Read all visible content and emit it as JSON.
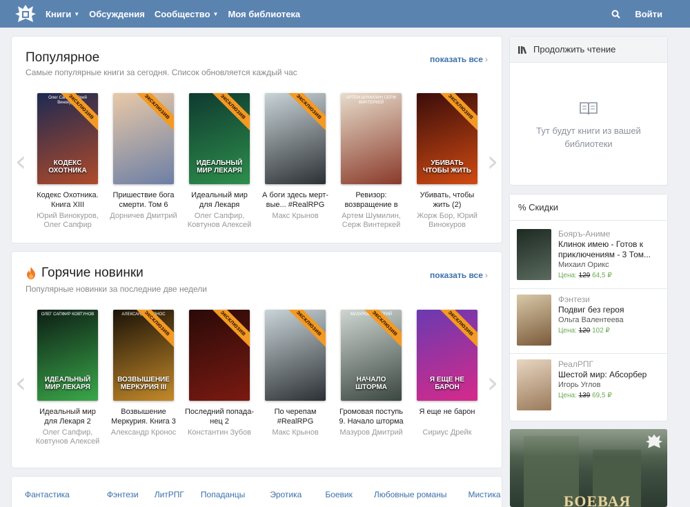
{
  "topbar": {
    "nav": [
      {
        "label": "Книги",
        "dropdown": true
      },
      {
        "label": "Обсуждения",
        "dropdown": false
      },
      {
        "label": "Сообщество",
        "dropdown": true
      },
      {
        "label": "Моя библиотека",
        "dropdown": false
      }
    ],
    "login_label": "Войти"
  },
  "popular": {
    "title": "Популярное",
    "subtitle": "Самые популярные книги за сегодня. Список обновляется каждый час",
    "show_all": "показать все",
    "books": [
      {
        "title": "Кодекс Охотника. Книга XIII",
        "author": "Юрий Винокуров, Олег Сапфир",
        "exclusive": true,
        "cover_top": "Олег Сапфир Юрий Винокуров",
        "cover_text": "КОДЕКС ОХОТНИКА",
        "colors": [
          "#1d2a52",
          "#b04a2a"
        ]
      },
      {
        "title": "Пришествие бога смерти. Том 6",
        "author": "Дорничев Дмитрий",
        "exclusive": true,
        "cover_top": "",
        "cover_text": "",
        "colors": [
          "#e9c9a7",
          "#6c7fa6"
        ]
      },
      {
        "title": "Идеальный мир для Лекаря",
        "author": "Олег Сапфир, Ковтунов Алексей",
        "exclusive": true,
        "cover_top": "",
        "cover_text": "ИДЕАЛЬНЫЙ МИР ЛЕКАРЯ",
        "colors": [
          "#0f3a30",
          "#2d8f4c"
        ]
      },
      {
        "title": "А боги здесь мерт­вые... #RealRPG",
        "author": "Макс Крынов",
        "exclusive": true,
        "cover_top": "",
        "cover_text": "",
        "colors": [
          "#c9d4d8",
          "#2c3034"
        ]
      },
      {
        "title": "Ревизор: возвраще­ние в СССР 5",
        "author": "Артем Шумилин, Серж Винтеркей",
        "exclusive": false,
        "cover_top": "АРТЕМ ШУМИЛИН СЕРЖ ВИНТЕРКЕЙ",
        "cover_text": "",
        "colors": [
          "#e7dccb",
          "#8a3a2a"
        ]
      },
      {
        "title": "Убивать, чтобы жить (2)",
        "author": "Жорж Бор, Юрий Винокуров",
        "exclusive": true,
        "cover_top": "",
        "cover_text": "УБИВАТЬ ЧТОБЫ ЖИТЬ",
        "colors": [
          "#3a0d0a",
          "#d04a12"
        ]
      }
    ]
  },
  "hot": {
    "title": "Горячие новинки",
    "subtitle": "Популярные новинки за последние две недели",
    "show_all": "показать все",
    "books": [
      {
        "title": "Идеальный мир для Лекаря 2",
        "author": "Олег Сапфир, Ковтунов Алексей",
        "exclusive": false,
        "cover_top": "ОЛЕГ САПФИР КОВТУНОВ",
        "cover_text": "ИДЕАЛЬНЫЙ МИР ЛЕКАРЯ",
        "colors": [
          "#0d1d14",
          "#3aa84a"
        ]
      },
      {
        "title": "Возвышение Меркурия. Книга 3",
        "author": "Александр Кронос",
        "exclusive": true,
        "cover_top": "АЛЕКСАНДР КРОНОС",
        "cover_text": "ВОЗВЫШЕНИЕ МЕРКУРИЯ III",
        "colors": [
          "#1a1208",
          "#c48a2a"
        ]
      },
      {
        "title": "Последний попада­нец 2",
        "author": "Константин Зубов",
        "exclusive": true,
        "cover_top": "",
        "cover_text": "",
        "colors": [
          "#2a0a08",
          "#7a1a12"
        ]
      },
      {
        "title": "По черепам #RealRPG",
        "author": "Макс Крынов",
        "exclusive": true,
        "cover_top": "",
        "cover_text": "",
        "colors": [
          "#c9d4d8",
          "#2c3034"
        ]
      },
      {
        "title": "Громовая поступь 9. Начало шторма",
        "author": "Мазуров Дмитрий",
        "exclusive": true,
        "cover_top": "МАЗУРОВ ДМИТРИЙ",
        "cover_text": "НАЧАЛО ШТОРМА",
        "colors": [
          "#cfd6d2",
          "#3a4640"
        ]
      },
      {
        "title": "Я еще не барон",
        "author": "Сириус Дрейк",
        "exclusive": true,
        "cover_top": "",
        "cover_text": "Я ЕЩЕ НЕ БАРОН",
        "colors": [
          "#6a3ab0",
          "#d62a8a"
        ]
      }
    ]
  },
  "continue": {
    "title": "Продолжить чтение",
    "empty_line1": "Тут будут книги из вашей",
    "empty_line2": "библиотеки"
  },
  "discounts": {
    "title": "% Скидки",
    "price_label": "Цена:",
    "items": [
      {
        "genre": "Бояръ-Аниме",
        "title": "Клинок имею - Готов к приключениям - 3 Том...",
        "author": "Михаил Орикс",
        "old_price": "129",
        "new_price": "64,5 ₽",
        "colors": [
          "#1c2a22",
          "#5b6a5e"
        ]
      },
      {
        "genre": "Фэнтези",
        "title": "Подвиг без героя",
        "author": "Ольга Валентеева",
        "old_price": "120",
        "new_price": "102 ₽",
        "colors": [
          "#d8c8a8",
          "#7a5a3a"
        ]
      },
      {
        "genre": "РеалРПГ",
        "title": "Шестой мир: Абсорбер",
        "author": "Игорь Углов",
        "old_price": "139",
        "new_price": "69,5 ₽",
        "colors": [
          "#e8d6c2",
          "#9a7a5a"
        ]
      }
    ]
  },
  "banner": {
    "text": "БОЕВАЯ"
  },
  "genres": [
    "Фантастика",
    "Фэнтези",
    "ЛитРПГ",
    "Попаданцы",
    "Эротика",
    "Боевик",
    "Любовные романы",
    "Мистика"
  ],
  "colors": {
    "header": "#5b83b0",
    "link": "#3c6fa8",
    "ribbon": "#f39a24",
    "price": "#6aa84f"
  }
}
